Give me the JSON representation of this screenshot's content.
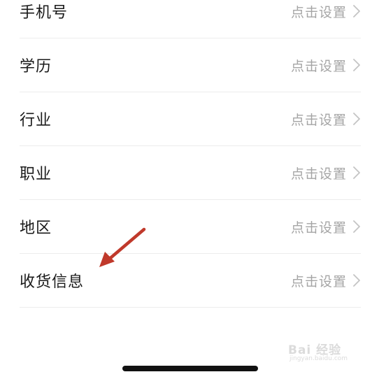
{
  "settings_list": {
    "items": [
      {
        "label": "手机号",
        "value": "点击设置"
      },
      {
        "label": "学历",
        "value": "点击设置"
      },
      {
        "label": "行业",
        "value": "点击设置"
      },
      {
        "label": "职业",
        "value": "点击设置"
      },
      {
        "label": "地区",
        "value": "点击设置"
      },
      {
        "label": "收货信息",
        "value": "点击设置"
      }
    ]
  },
  "annotation": {
    "arrow_color": "#c0392b"
  },
  "watermark": {
    "brand": "Bai 经验",
    "domain": "jingyan.baidu.com"
  },
  "icons": {
    "row_chevron": "chevron-right-icon",
    "annotation_arrow": "arrow-annotation-icon"
  }
}
